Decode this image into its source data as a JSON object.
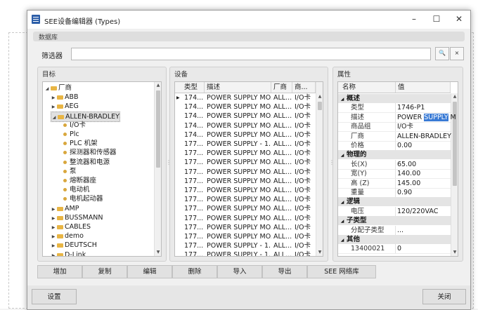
{
  "window": {
    "title": "SEE设备编辑器 (Types)",
    "section_label": "数据库",
    "filter_label": "筛选器",
    "filter_value": "",
    "filter_search_glyph": "🔍",
    "filter_clear_glyph": "×"
  },
  "target_panel": {
    "header": "目标",
    "items": [
      {
        "label": "厂商",
        "level": 0,
        "kind": "folder",
        "expanded": true
      },
      {
        "label": "ABB",
        "level": 1,
        "kind": "folder",
        "expanded": false
      },
      {
        "label": "AEG",
        "level": 1,
        "kind": "folder",
        "expanded": false
      },
      {
        "label": "ALLEN-BRADLEY",
        "level": 1,
        "kind": "folder",
        "expanded": true,
        "selected": true
      },
      {
        "label": "I/O卡",
        "level": 2,
        "kind": "leaf"
      },
      {
        "label": "Plc",
        "level": 2,
        "kind": "leaf"
      },
      {
        "label": "PLC 机架",
        "level": 2,
        "kind": "leaf"
      },
      {
        "label": "探测器和传感器",
        "level": 2,
        "kind": "leaf"
      },
      {
        "label": "整流器和电源",
        "level": 2,
        "kind": "leaf"
      },
      {
        "label": "泵",
        "level": 2,
        "kind": "leaf"
      },
      {
        "label": "熔断器座",
        "level": 2,
        "kind": "leaf"
      },
      {
        "label": "电动机",
        "level": 2,
        "kind": "leaf"
      },
      {
        "label": "电机起动器",
        "level": 2,
        "kind": "leaf"
      },
      {
        "label": "AMP",
        "level": 1,
        "kind": "folder",
        "expanded": false
      },
      {
        "label": "BUSSMANN",
        "level": 1,
        "kind": "folder",
        "expanded": false
      },
      {
        "label": "CABLES",
        "level": 1,
        "kind": "folder",
        "expanded": false
      },
      {
        "label": "demo",
        "level": 1,
        "kind": "folder",
        "expanded": false
      },
      {
        "label": "DEUTSCH",
        "level": 1,
        "kind": "folder",
        "expanded": false
      },
      {
        "label": "D-Link",
        "level": 1,
        "kind": "folder",
        "expanded": false
      }
    ]
  },
  "device_panel": {
    "header": "设备",
    "columns": [
      "类型",
      "描述",
      "厂商",
      "商..."
    ],
    "rows": [
      [
        "174...",
        "POWER SUPPLY MO...",
        "ALL...",
        "I/O卡"
      ],
      [
        "174...",
        "POWER SUPPLY MO...",
        "ALL...",
        "I/O卡"
      ],
      [
        "174...",
        "POWER SUPPLY MO...",
        "ALL...",
        "I/O卡"
      ],
      [
        "174...",
        "POWER SUPPLY MO...",
        "ALL...",
        "I/O卡"
      ],
      [
        "174...",
        "POWER SUPPLY MO...",
        "ALL...",
        "I/O卡"
      ],
      [
        "177...",
        "POWER SUPPLY - 1...",
        "ALL...",
        "I/O卡"
      ],
      [
        "177...",
        "POWER SUPPLY MO...",
        "ALL...",
        "I/O卡"
      ],
      [
        "177...",
        "POWER SUPPLY MO...",
        "ALL...",
        "I/O卡"
      ],
      [
        "177...",
        "POWER SUPPLY MO...",
        "ALL...",
        "I/O卡"
      ],
      [
        "177...",
        "POWER SUPPLY MO...",
        "ALL...",
        "I/O卡"
      ],
      [
        "177...",
        "POWER SUPPLY MO...",
        "ALL...",
        "I/O卡"
      ],
      [
        "177...",
        "POWER SUPPLY MO...",
        "ALL...",
        "I/O卡"
      ],
      [
        "177...",
        "POWER SUPPLY MO...",
        "ALL...",
        "I/O卡"
      ],
      [
        "177...",
        "POWER SUPPLY MO...",
        "ALL...",
        "I/O卡"
      ],
      [
        "177...",
        "POWER SUPPLY MO...",
        "ALL...",
        "I/O卡"
      ],
      [
        "177...",
        "POWER SUPPLY MO...",
        "ALL...",
        "I/O卡"
      ],
      [
        "177...",
        "POWER SUPPLY - 1...",
        "ALL...",
        "I/O卡"
      ],
      [
        "177...",
        "POWER SUPPLY - 1...",
        "ALL...",
        "I/O卡"
      ]
    ]
  },
  "props_panel": {
    "header": "属性",
    "col_name": "名称",
    "col_value": "值",
    "groups": [
      {
        "title": "概述",
        "rows": [
          {
            "name": "类型",
            "value": "1746-P1"
          },
          {
            "name": "描述",
            "value_before": "POWER ",
            "value_selected": "SUPPLY",
            "value_after": " M"
          },
          {
            "name": "商品组",
            "value": "I/O卡"
          },
          {
            "name": "厂商",
            "value": "ALLEN-BRADLEY"
          },
          {
            "name": "价格",
            "value": "0.00"
          }
        ]
      },
      {
        "title": "物理的",
        "rows": [
          {
            "name": "长(X)",
            "value": "65.00"
          },
          {
            "name": "宽(Y)",
            "value": "140.00"
          },
          {
            "name": "高 (Z)",
            "value": "145.00"
          },
          {
            "name": "重量",
            "value": "0.90"
          }
        ]
      },
      {
        "title": "逻辑",
        "rows": [
          {
            "name": "电压",
            "value": "120/220VAC"
          }
        ]
      },
      {
        "title": "子类型",
        "rows": [
          {
            "name": "分配子类型",
            "value": "..."
          }
        ]
      },
      {
        "title": "其他",
        "rows": [
          {
            "name": "13400021",
            "value": "0"
          }
        ]
      }
    ]
  },
  "toolbar": {
    "buttons": [
      "增加",
      "复制",
      "编辑",
      "删除",
      "导入",
      "导出",
      "SEE 网络库"
    ]
  },
  "footer": {
    "settings_label": "设置",
    "close_label": "关闭"
  },
  "colors": {
    "accent": "#3a7bd5",
    "folder": "#e8b544"
  }
}
